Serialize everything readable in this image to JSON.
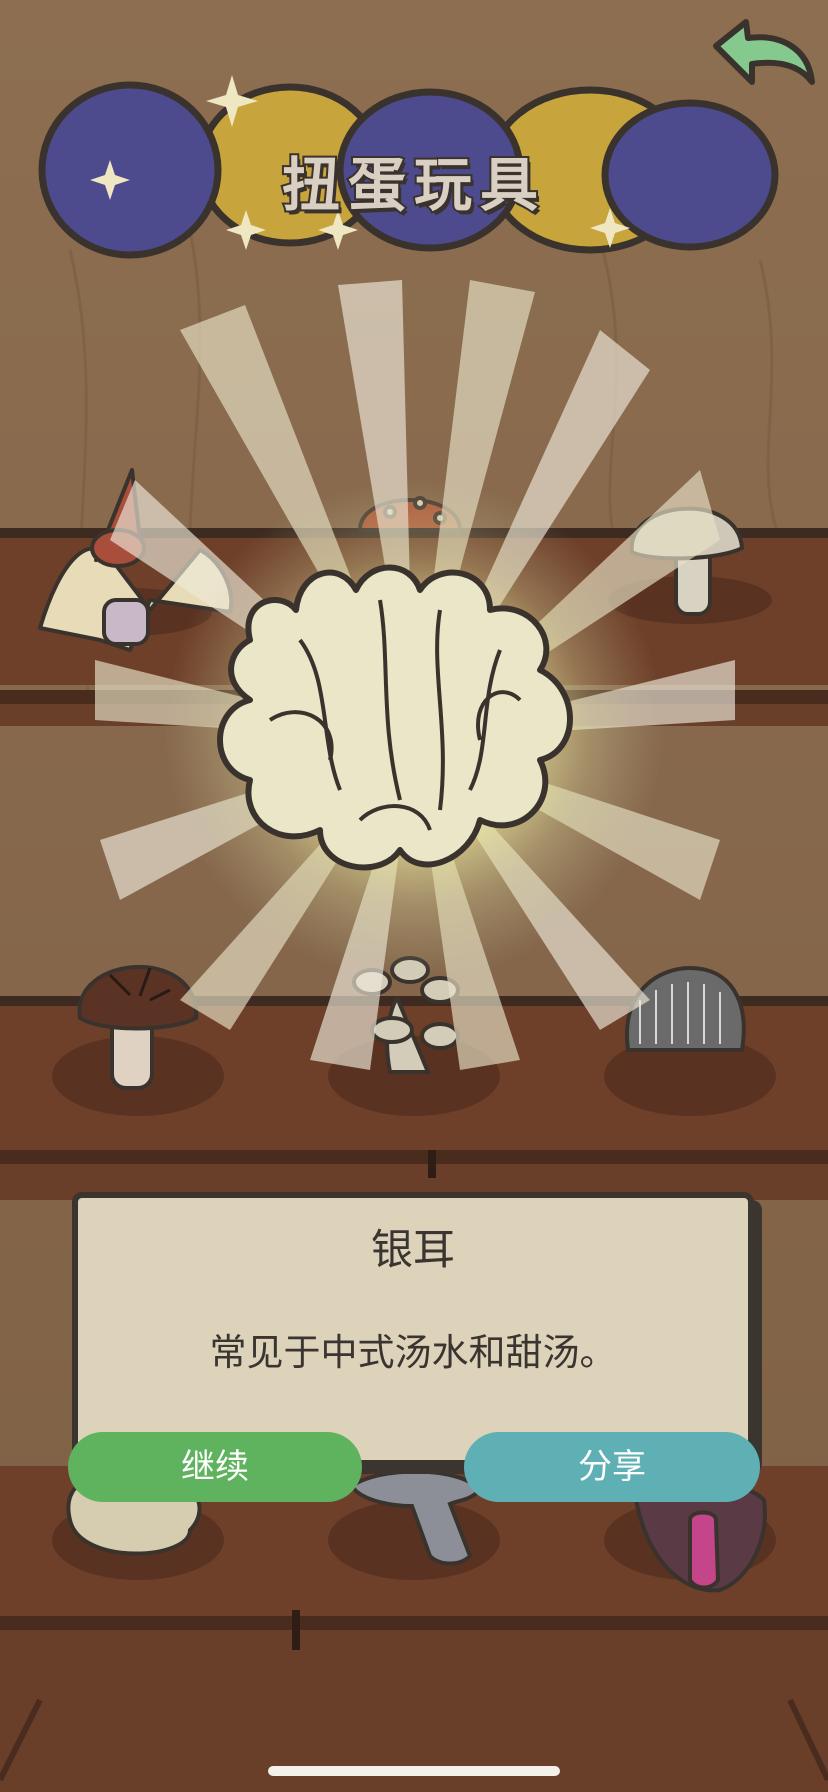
{
  "header": {
    "title": "扭蛋玩具",
    "back_icon": "back-arrow-icon"
  },
  "reward": {
    "name": "银耳",
    "description": "常见于中式汤水和甜汤。",
    "image_icon": "white-fungus-icon"
  },
  "actions": {
    "continue_label": "继续",
    "share_label": "分享"
  },
  "shelf_items": [
    "pterodactyl-icon",
    "amanita-mushroom-icon",
    "white-button-mushroom-icon",
    "shiitake-mushroom-icon",
    "enoki-cluster-mushroom-icon",
    "lions-mane-mushroom-icon",
    "coral-fungus-icon",
    "oyster-mushroom-icon",
    "monster-mushroom-icon"
  ],
  "colors": {
    "wall": "#8a6a4c",
    "shelf": "#6b3d26",
    "card": "#ddd3bb",
    "continue": "#5fb35e",
    "share": "#5eb0b5",
    "capsule_blue": "#4d4b8e",
    "capsule_yellow": "#c8a43c"
  }
}
